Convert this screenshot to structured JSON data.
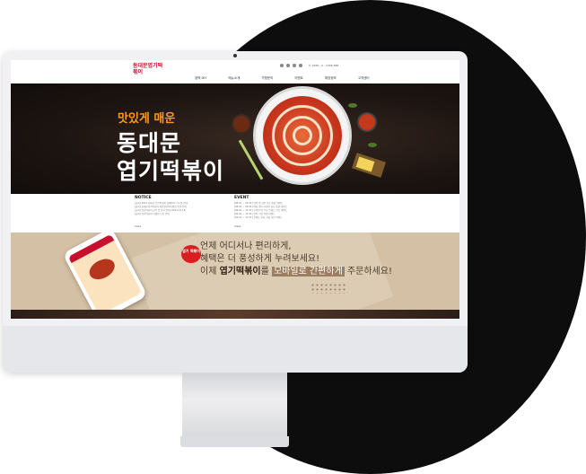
{
  "site": {
    "logo_text": "동대문엽기떡볶이",
    "nav": [
      "엽떡 DIY",
      "메뉴소개",
      "가맹문의",
      "이벤트",
      "매장정보",
      "고객센터"
    ],
    "tel": "✆ 1588 - 0 - 1588 888"
  },
  "banner": {
    "subtitle": "맛있게 매운",
    "title_line1": "동대문",
    "title_line2": "엽기떡볶이"
  },
  "notice": {
    "heading": "NOTICE",
    "items": [
      "[공지] 2021 동대문 엽기떡볶이 홈페이지 리뉴얼 안내",
      "[공지] 동대문엽기떡볶이 개인정보처리방침 변경 안내",
      "[공지] 엽기떡볶이 공식 앱 출시 안내 (2021.12.13)",
      "[공지] 엽기떡볶이 가맹점 모집 안내"
    ],
    "more": "more"
  },
  "event": {
    "heading": "EVENT",
    "items": [
      "[08.01 ~ 10.31] 엽떡 앱 할인 쿠폰 증정 이벤트",
      "[08.01 ~ 08.31] 여름 맞이 시원한 음료 증정 이벤트",
      "[06.01 ~ 12.31] 모바일 앱 주문 스탬프 적립 이벤트",
      "[05.01 ~ 12.31] 엽떡 리뷰 작성 이벤트",
      "[05.01 ~ 12.31] 신메뉴 출시 기념 할인 이벤트"
    ],
    "more": "more"
  },
  "mobile": {
    "badge": "엽기 떡볶이",
    "line1": "언제 어디서나 편리하게,",
    "line2": "혜택은 더 풍성하게 누려보세요!",
    "line3_pre": "이제 ",
    "line3_brand": "엽기떡볶이",
    "line3_mid": "를 ",
    "line3_hl": "모바일로 간편하게",
    "line3_post": " 주문하세요!"
  },
  "colors": {
    "accent": "#c8102e",
    "banner_orange": "#ff9a1f",
    "mobile_bg": "#d4c0a4",
    "circle": "#0d0d0d"
  }
}
